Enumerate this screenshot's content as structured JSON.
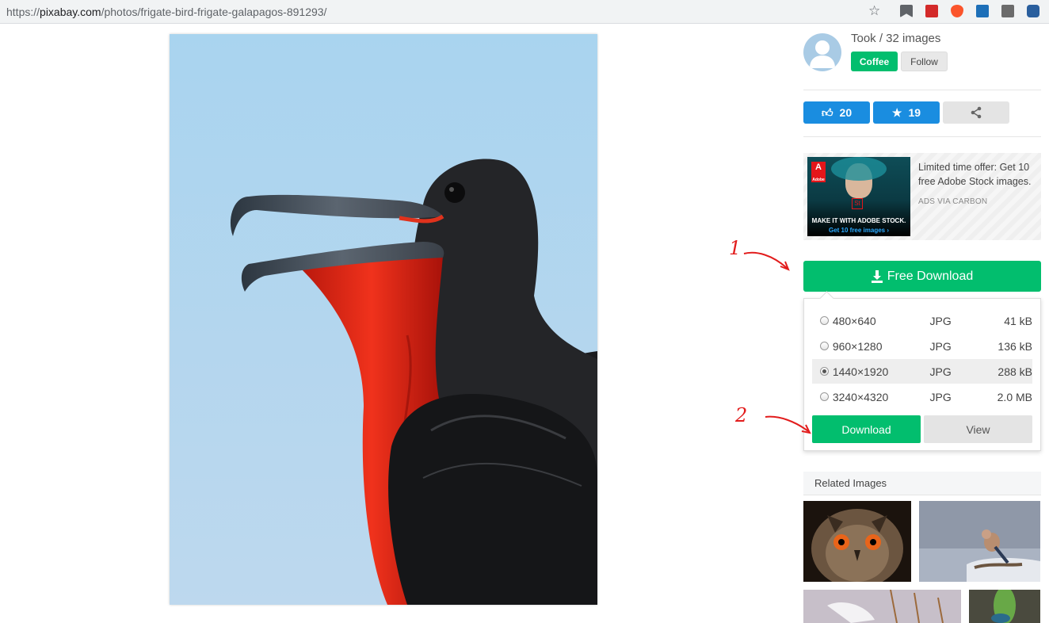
{
  "browser": {
    "url_prefix": "https://",
    "url_host": "pixabay.com",
    "url_path": "/photos/frigate-bird-frigate-galapagos-891293/"
  },
  "author": {
    "name_line": "Took / 32 images",
    "coffee_label": "Coffee",
    "follow_label": "Follow"
  },
  "stats": {
    "likes": "20",
    "favorites": "19"
  },
  "ad": {
    "text": "Limited time offer: Get 10 free Adobe Stock images.",
    "via": "ADS VIA CARBON",
    "image_tagline": "MAKE IT WITH ADOBE STOCK.",
    "image_link": "Get 10 free images ›",
    "logo_letter": "A",
    "logo_word": "Adobe",
    "st": "St"
  },
  "download": {
    "button_label": "Free Download",
    "sizes": [
      {
        "dim": "480×640",
        "format": "JPG",
        "size": "41 kB",
        "selected": false
      },
      {
        "dim": "960×1280",
        "format": "JPG",
        "size": "136 kB",
        "selected": false
      },
      {
        "dim": "1440×1920",
        "format": "JPG",
        "size": "288 kB",
        "selected": true
      },
      {
        "dim": "3240×4320",
        "format": "JPG",
        "size": "2.0 MB",
        "selected": false
      }
    ],
    "download_label": "Download",
    "view_label": "View"
  },
  "annotations": {
    "one": "1",
    "two": "2"
  },
  "related": {
    "heading": "Related Images"
  },
  "colors": {
    "green": "#02be6e",
    "blue": "#1a8de0",
    "annotation_red": "#e21c1c"
  }
}
